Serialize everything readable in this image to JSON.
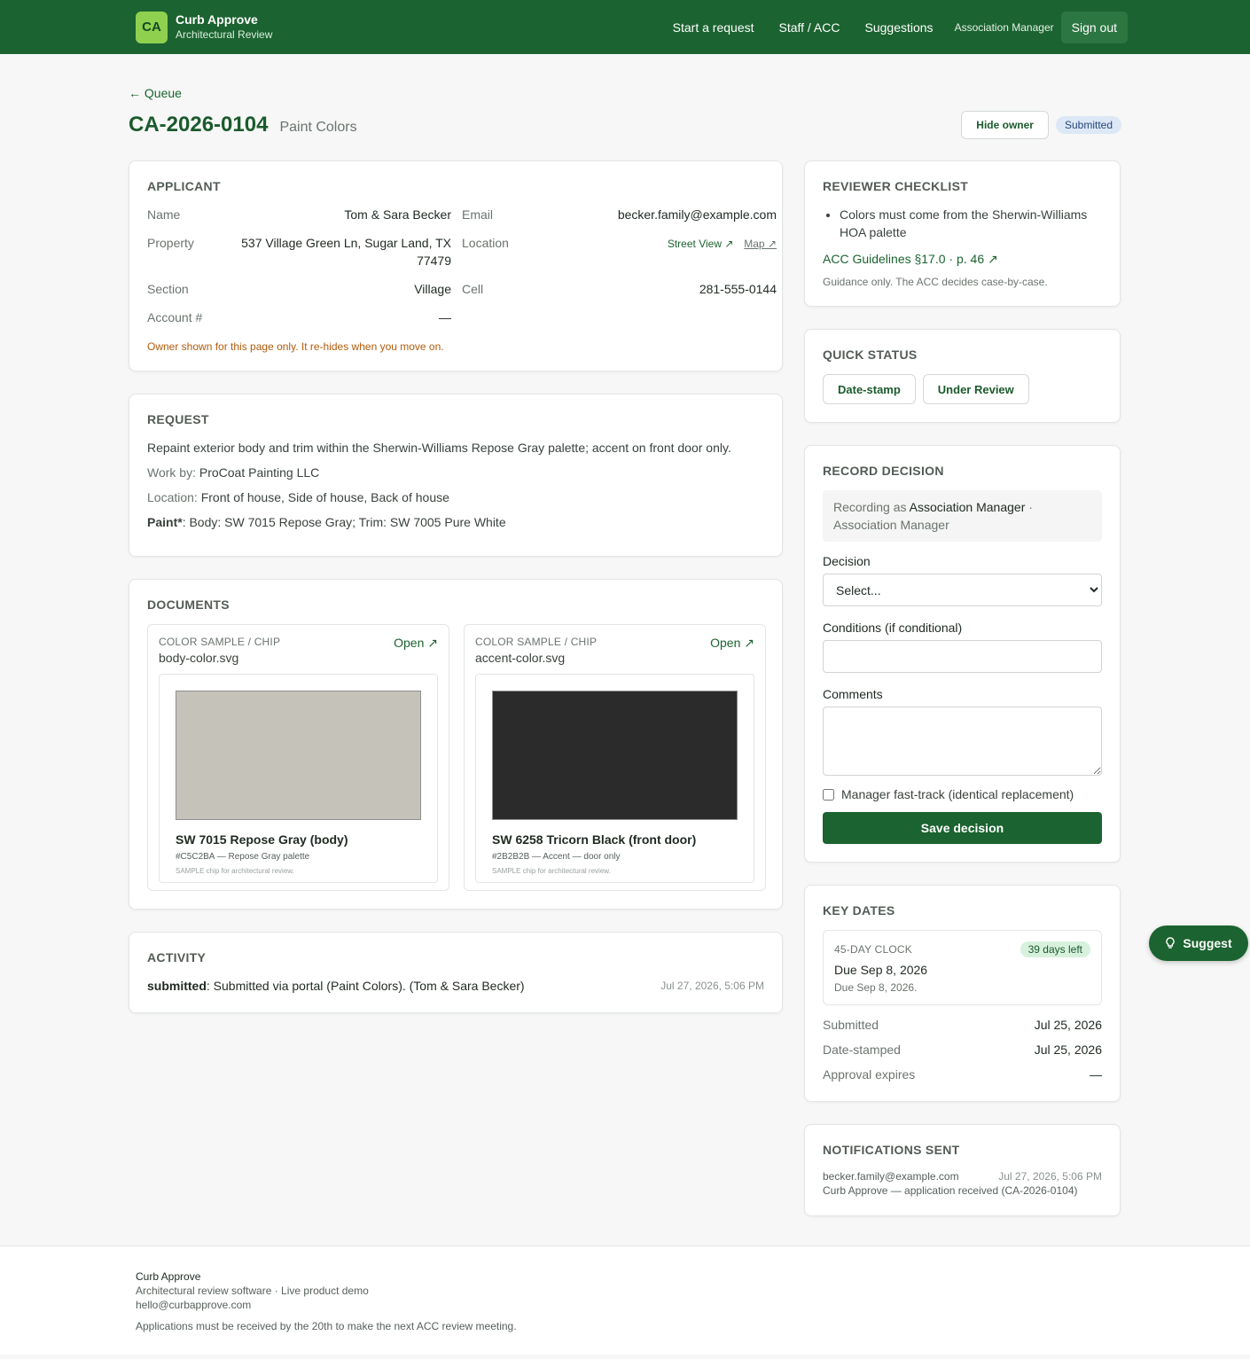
{
  "header": {
    "logo": "CA",
    "brand_name": "Curb Approve",
    "brand_sub": "Architectural Review",
    "nav": [
      "Start a request",
      "Staff / ACC",
      "Suggestions"
    ],
    "role": "Association Manager",
    "sign_out": "Sign out"
  },
  "page": {
    "back": "← Queue",
    "case_id": "CA-2026-0104",
    "case_type": "Paint Colors",
    "hide_owner": "Hide owner",
    "status": "Submitted"
  },
  "applicant": {
    "heading": "Applicant",
    "name_label": "Name",
    "name": "Tom & Sara Becker",
    "email_label": "Email",
    "email": "becker.family@example.com",
    "property_label": "Property",
    "property_line1": "537 Village Green Ln, Sugar Land, TX",
    "property_line2": "77479",
    "location_label": "Location",
    "street_view": "Street View ↗",
    "map": "Map ↗",
    "section_label": "Section",
    "section": "Village",
    "cell_label": "Cell",
    "cell": "281-555-0144",
    "account_label": "Account #",
    "account": "—",
    "warning": "Owner shown for this page only. It re-hides when you move on."
  },
  "request": {
    "heading": "Request",
    "description": "Repaint exterior body and trim within the Sherwin-Williams Repose Gray palette; accent on front door only.",
    "work_by_label": "Work by:",
    "work_by": "ProCoat Painting LLC",
    "location_label": "Location:",
    "location": "Front of house, Side of house, Back of house",
    "paint_label": "Paint*",
    "paint": ": Body: SW 7015 Repose Gray; Trim: SW 7005 Pure White"
  },
  "documents": {
    "heading": "Documents",
    "items": [
      {
        "kind": "Color sample / chip",
        "file": "body-color.svg",
        "open": "Open ↗",
        "swatch": "#C5C2BA",
        "name": "SW 7015 Repose Gray (body)",
        "hex": "#C5C2BA — Repose Gray palette",
        "note": "SAMPLE chip for architectural review."
      },
      {
        "kind": "Color sample / chip",
        "file": "accent-color.svg",
        "open": "Open ↗",
        "swatch": "#2B2B2B",
        "name": "SW 6258 Tricorn Black (front door)",
        "hex": "#2B2B2B — Accent — door only",
        "note": "SAMPLE chip for architectural review."
      }
    ]
  },
  "activity": {
    "heading": "Activity",
    "event_label": "submitted",
    "event_text": ": Submitted via portal (Paint Colors). (Tom & Sara Becker)",
    "when": "Jul 27, 2026, 5:06 PM"
  },
  "checklist": {
    "heading": "Reviewer checklist",
    "items": [
      "Colors must come from the Sherwin-Williams HOA palette"
    ],
    "guide_link": "ACC Guidelines §17.0 · p. 46 ↗",
    "note": "Guidance only. The ACC decides case-by-case."
  },
  "quick_status": {
    "heading": "Quick status",
    "date_stamp": "Date-stamp",
    "under_review": "Under Review"
  },
  "decision": {
    "heading": "Record decision",
    "recording_prefix": "Recording as",
    "recording_name": "Association Manager",
    "recording_suffix": " ·",
    "recording_role": "Association Manager",
    "decision_label": "Decision",
    "decision_value": "Select...",
    "conditions_label": "Conditions (if conditional)",
    "comments_label": "Comments",
    "fast_track": "Manager fast-track (identical replacement)",
    "save": "Save decision"
  },
  "key_dates": {
    "heading": "Key dates",
    "clock_title": "45-day clock",
    "days_left": "39 days left",
    "due_main": "Due Sep 8, 2026",
    "due_sub": "Due Sep 8, 2026.",
    "rows": [
      {
        "k": "Submitted",
        "v": "Jul 25, 2026"
      },
      {
        "k": "Date-stamped",
        "v": "Jul 25, 2026"
      },
      {
        "k": "Approval expires",
        "v": "—"
      }
    ]
  },
  "notifications": {
    "heading": "Notifications sent",
    "to": "becker.family@example.com",
    "when": "Jul 27, 2026, 5:06 PM",
    "subject": "Curb Approve — application received (CA-2026-0104)"
  },
  "suggest": "Suggest",
  "footer": {
    "name": "Curb Approve",
    "tagline": "Architectural review software · Live product demo",
    "email": "hello@curbapprove.com",
    "note": "Applications must be received by the 20th to make the next ACC review meeting."
  }
}
